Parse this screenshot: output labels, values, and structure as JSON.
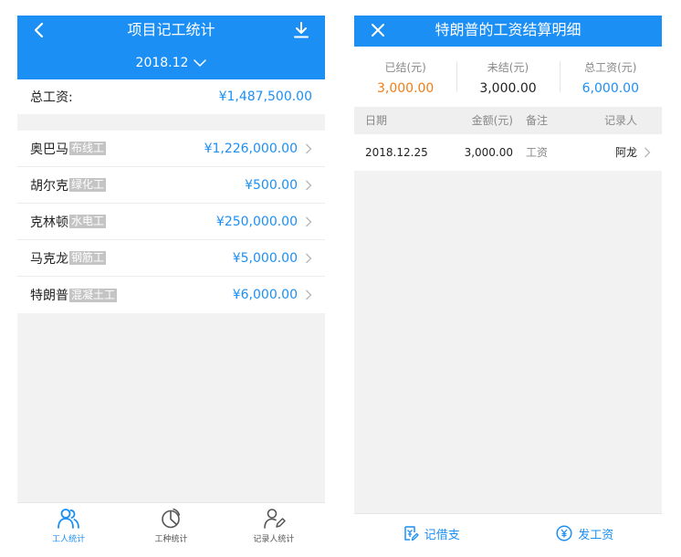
{
  "colors": {
    "accent": "#1c8ff5",
    "settled": "#f07d15",
    "background": "#f2f2f2"
  },
  "left": {
    "header": {
      "title": "项目记工统计",
      "month": "2018.12"
    },
    "total": {
      "label": "总工资:",
      "value": "¥1,487,500.00"
    },
    "workers": [
      {
        "name": "奥巴马",
        "trade": "布线工",
        "amount": "¥1,226,000.00"
      },
      {
        "name": "胡尔克",
        "trade": "绿化工",
        "amount": "¥500.00"
      },
      {
        "name": "克林顿",
        "trade": "水电工",
        "amount": "¥250,000.00"
      },
      {
        "name": "马克龙",
        "trade": "钢筋工",
        "amount": "¥5,000.00"
      },
      {
        "name": "特朗普",
        "trade": "混凝土工",
        "amount": "¥6,000.00"
      }
    ],
    "tabs": [
      {
        "label": "工人统计",
        "icon": "people-icon",
        "active": true
      },
      {
        "label": "工种统计",
        "icon": "pie-chart-icon",
        "active": false
      },
      {
        "label": "记录人统计",
        "icon": "person-edit-icon",
        "active": false
      }
    ]
  },
  "right": {
    "header": {
      "title": "特朗普的工资结算明细"
    },
    "summary": [
      {
        "label": "已结(元)",
        "value": "3,000.00"
      },
      {
        "label": "未结(元)",
        "value": "3,000.00"
      },
      {
        "label": "总工资(元)",
        "value": "6,000.00"
      }
    ],
    "table": {
      "columns": [
        "日期",
        "金额(元)",
        "备注",
        "记录人"
      ],
      "rows": [
        {
          "date": "2018.12.25",
          "amount": "3,000.00",
          "note": "工资",
          "recorder": "阿龙"
        }
      ]
    },
    "actions": {
      "borrow": "记借支",
      "pay": "发工资"
    }
  }
}
